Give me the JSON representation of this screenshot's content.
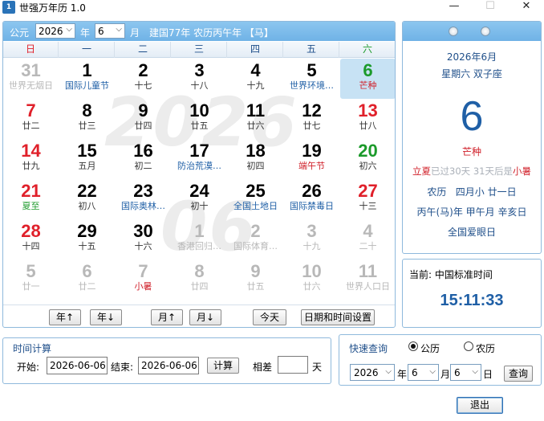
{
  "window": {
    "title": "世强万年历 1.0",
    "icon_name": "calendar-app-icon",
    "minimize": "—",
    "maximize": "☐",
    "close": "✕"
  },
  "colors": {
    "accent": "#6fb2e6",
    "sunday_red": "#e0202a",
    "saturday_green": "#1b9a2a",
    "festival_blue": "#1f5fa6",
    "dim_gray": "#b8b8b8",
    "term_red": "#d0202a"
  },
  "header": {
    "era_label": "公元",
    "year_value": "2026",
    "year_unit": "年",
    "month_value": "6",
    "month_unit": "月",
    "info": "建国77年 农历丙午年 【马】"
  },
  "weekdays": [
    "日",
    "一",
    "二",
    "三",
    "四",
    "五",
    "六"
  ],
  "watermark": {
    "year": "2026",
    "month": "06"
  },
  "calendar": {
    "rows": [
      [
        {
          "day": "31",
          "sub": "世界无烟日",
          "style": "dim"
        },
        {
          "day": "1",
          "sub": "国际儿童节",
          "style": "fest"
        },
        {
          "day": "2",
          "sub": "十七",
          "style": "normal"
        },
        {
          "day": "3",
          "sub": "十八",
          "style": "normal"
        },
        {
          "day": "4",
          "sub": "十九",
          "style": "normal"
        },
        {
          "day": "5",
          "sub": "世界环境…",
          "style": "fest"
        },
        {
          "day": "6",
          "sub": "芒种",
          "style": "sat-term",
          "today": true
        }
      ],
      [
        {
          "day": "7",
          "sub": "廿二",
          "style": "sun"
        },
        {
          "day": "8",
          "sub": "廿三",
          "style": "normal"
        },
        {
          "day": "9",
          "sub": "廿四",
          "style": "normal"
        },
        {
          "day": "10",
          "sub": "廿五",
          "style": "normal"
        },
        {
          "day": "11",
          "sub": "廿六",
          "style": "normal"
        },
        {
          "day": "12",
          "sub": "廿七",
          "style": "normal"
        },
        {
          "day": "13",
          "sub": "廿八",
          "style": "sat-red"
        }
      ],
      [
        {
          "day": "14",
          "sub": "廿九",
          "style": "sun"
        },
        {
          "day": "15",
          "sub": "五月",
          "style": "normal"
        },
        {
          "day": "16",
          "sub": "初二",
          "style": "normal"
        },
        {
          "day": "17",
          "sub": "防治荒漠…",
          "style": "fest"
        },
        {
          "day": "18",
          "sub": "初四",
          "style": "normal"
        },
        {
          "day": "19",
          "sub": "端午节",
          "style": "festred"
        },
        {
          "day": "20",
          "sub": "初六",
          "style": "sat"
        }
      ],
      [
        {
          "day": "21",
          "sub": "夏至",
          "style": "sun-term"
        },
        {
          "day": "22",
          "sub": "初八",
          "style": "normal"
        },
        {
          "day": "23",
          "sub": "国际奥林…",
          "style": "fest"
        },
        {
          "day": "24",
          "sub": "初十",
          "style": "normal"
        },
        {
          "day": "25",
          "sub": "全国土地日",
          "style": "fest"
        },
        {
          "day": "26",
          "sub": "国际禁毒日",
          "style": "fest"
        },
        {
          "day": "27",
          "sub": "十三",
          "style": "sat-red"
        }
      ],
      [
        {
          "day": "28",
          "sub": "十四",
          "style": "sun"
        },
        {
          "day": "29",
          "sub": "十五",
          "style": "normal"
        },
        {
          "day": "30",
          "sub": "十六",
          "style": "normal"
        },
        {
          "day": "1",
          "sub": "香港回归…",
          "style": "dim"
        },
        {
          "day": "2",
          "sub": "国际体育…",
          "style": "dim"
        },
        {
          "day": "3",
          "sub": "十九",
          "style": "dim"
        },
        {
          "day": "4",
          "sub": "二十",
          "style": "dim"
        }
      ],
      [
        {
          "day": "5",
          "sub": "廿一",
          "style": "dim"
        },
        {
          "day": "6",
          "sub": "廿二",
          "style": "dim"
        },
        {
          "day": "7",
          "sub": "小暑",
          "style": "dim-term"
        },
        {
          "day": "8",
          "sub": "廿四",
          "style": "dim"
        },
        {
          "day": "9",
          "sub": "廿五",
          "style": "dim"
        },
        {
          "day": "10",
          "sub": "廿六",
          "style": "dim"
        },
        {
          "day": "11",
          "sub": "世界人口日",
          "style": "dim"
        }
      ]
    ]
  },
  "nav": {
    "year_up": "年↑",
    "year_down": "年↓",
    "month_up": "月↑",
    "month_down": "月↓",
    "today": "今天",
    "settings": "日期和时间设置"
  },
  "info": {
    "year_month": "2026年6月",
    "weekday_zodiac": "星期六  双子座",
    "big_day": "6",
    "term": "芒种",
    "term_prev_name": "立夏",
    "term_prev_text": "已过30天",
    "term_next_text": "31天后是",
    "term_next_name": "小暑",
    "lunar_label": "农历",
    "lunar_month": "四月小",
    "lunar_day": "廿一日",
    "ganzhi_year": "丙午(马)年",
    "ganzhi_month": "甲午月",
    "ganzhi_day": "辛亥日",
    "festival": "全国爱眼日"
  },
  "clock": {
    "label": "当前: 中国标准时间",
    "time": "15:11:33"
  },
  "calc": {
    "title": "时间计算",
    "start_label": "开始:",
    "start_value": "2026-06-06",
    "end_label": "结束:",
    "end_value": "2026-06-06",
    "calc_button": "计算",
    "diff_label": "相差",
    "diff_value": "",
    "unit": "天"
  },
  "query": {
    "title": "快速查询",
    "radio_solar": "公历",
    "radio_lunar": "农历",
    "solar_selected": true,
    "year": "2026",
    "year_unit": "年",
    "month": "6",
    "month_unit": "月",
    "day": "6",
    "day_unit": "日",
    "query_button": "查询"
  },
  "exit_button": "退出"
}
